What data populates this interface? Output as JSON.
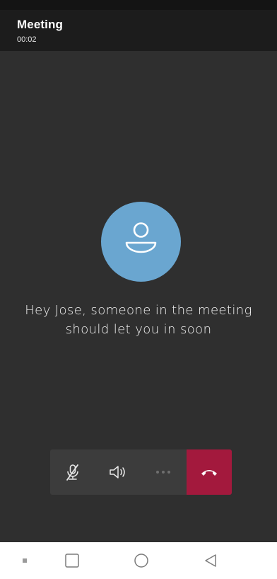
{
  "header": {
    "title": "Meeting",
    "timer": "00:02"
  },
  "lobby": {
    "avatar_icon": "person-icon",
    "message": "Hey Jose, someone in the meeting should let you in soon"
  },
  "call_controls": {
    "mic_icon": "mic-off-icon",
    "speaker_icon": "speaker-icon",
    "more_icon": "more-options-icon",
    "hangup_icon": "hang-up-icon",
    "hangup_color": "#a3193d"
  },
  "nav_bar": {
    "items": [
      "notifications-dot-icon",
      "recents-square-icon",
      "home-circle-icon",
      "back-triangle-icon"
    ]
  },
  "colors": {
    "background": "#2f2f2f",
    "header": "#1c1c1c",
    "avatar": "#6aa6d0",
    "control_bar": "#3c3c3c"
  }
}
